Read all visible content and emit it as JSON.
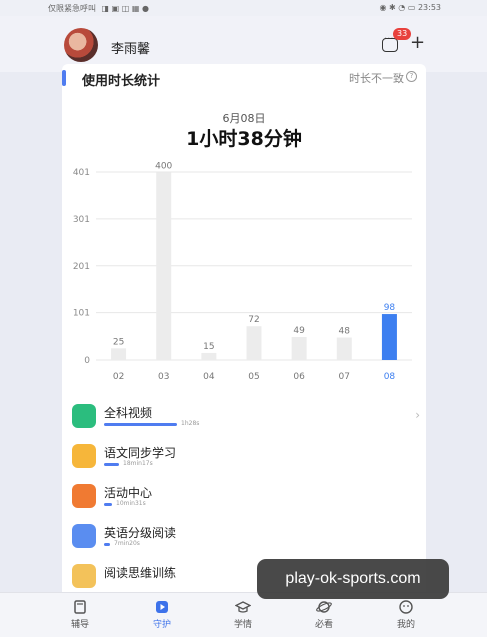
{
  "status": {
    "left_text": "仅限紧急呼叫",
    "time": "23:53"
  },
  "header": {
    "username": "李雨馨",
    "message_badge": "33"
  },
  "stats": {
    "title": "使用时长统计",
    "note": "时长不一致",
    "date": "6月08日",
    "total": "1小时38分钟"
  },
  "chart_data": {
    "type": "bar",
    "categories": [
      "02",
      "03",
      "04",
      "05",
      "06",
      "07",
      "08"
    ],
    "values": [
      25,
      400,
      15,
      72,
      49,
      48,
      98
    ],
    "yticks": [
      "401",
      "301",
      "201",
      "101",
      "0"
    ],
    "ylim": [
      0,
      401
    ],
    "highlight_index": 6,
    "colors": {
      "bar": "#ececec",
      "highlight": "#3d7ff0",
      "grid": "#e7e7e7"
    }
  },
  "apps": [
    {
      "name": "全科视频",
      "time": "1h28s",
      "progress": 0.52
    },
    {
      "name": "语文同步学习",
      "time": "18min17s",
      "progress": 0.11
    },
    {
      "name": "活动中心",
      "time": "10min31s",
      "progress": 0.06
    },
    {
      "name": "英语分级阅读",
      "time": "7min20s",
      "progress": 0.04
    },
    {
      "name": "阅读思维训练",
      "time": "",
      "progress": 0
    }
  ],
  "tabs": [
    {
      "label": "辅导",
      "icon": "book-icon"
    },
    {
      "label": "守护",
      "icon": "shield-play-icon",
      "active": true
    },
    {
      "label": "学情",
      "icon": "graduation-cap-icon"
    },
    {
      "label": "必看",
      "icon": "planet-icon"
    },
    {
      "label": "我的",
      "icon": "face-icon"
    }
  ],
  "watermark": "play-ok-sports.com"
}
